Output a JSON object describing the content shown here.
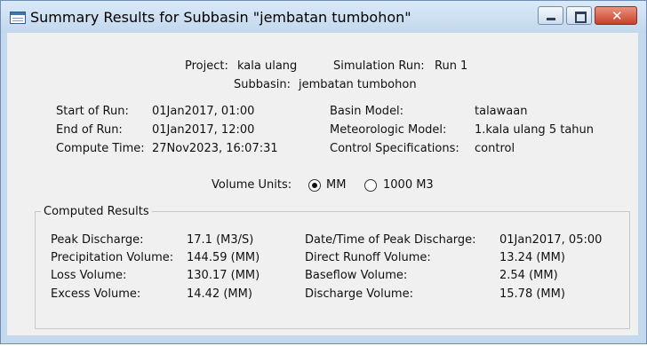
{
  "window": {
    "title": "Summary Results for Subbasin \"jembatan tumbohon\""
  },
  "header": {
    "project_label": "Project:",
    "project_value": "kala ulang",
    "sim_label": "Simulation Run:",
    "sim_value": "Run 1",
    "subbasin_label": "Subbasin:",
    "subbasin_value": "jembatan tumbohon"
  },
  "run_info": {
    "start_label": "Start of Run:",
    "start_value": "01Jan2017, 01:00",
    "end_label": "End of Run:",
    "end_value": "01Jan2017, 12:00",
    "compute_label": "Compute Time:",
    "compute_value": "27Nov2023, 16:07:31",
    "basin_label": "Basin Model:",
    "basin_value": "talawaan",
    "met_label": "Meteorologic Model:",
    "met_value": "1.kala ulang 5 tahun",
    "control_label": "Control Specifications:",
    "control_value": "control"
  },
  "units": {
    "label": "Volume Units:",
    "options": [
      "MM",
      "1000 M3"
    ],
    "selected": "MM"
  },
  "results": {
    "group_label": "Computed Results",
    "peak_discharge_label": "Peak Discharge:",
    "peak_discharge_value": "17.1 (M3/S)",
    "precip_label": "Precipitation Volume:",
    "precip_value": "144.59 (MM)",
    "loss_label": "Loss Volume:",
    "loss_value": "130.17 (MM)",
    "excess_label": "Excess Volume:",
    "excess_value": "14.42 (MM)",
    "peak_time_label": "Date/Time of Peak Discharge:",
    "peak_time_value": "01Jan2017, 05:00",
    "direct_label": "Direct Runoff Volume:",
    "direct_value": "13.24 (MM)",
    "baseflow_label": "Baseflow Volume:",
    "baseflow_value": "2.54 (MM)",
    "discharge_label": "Discharge Volume:",
    "discharge_value": "15.78 (MM)"
  }
}
